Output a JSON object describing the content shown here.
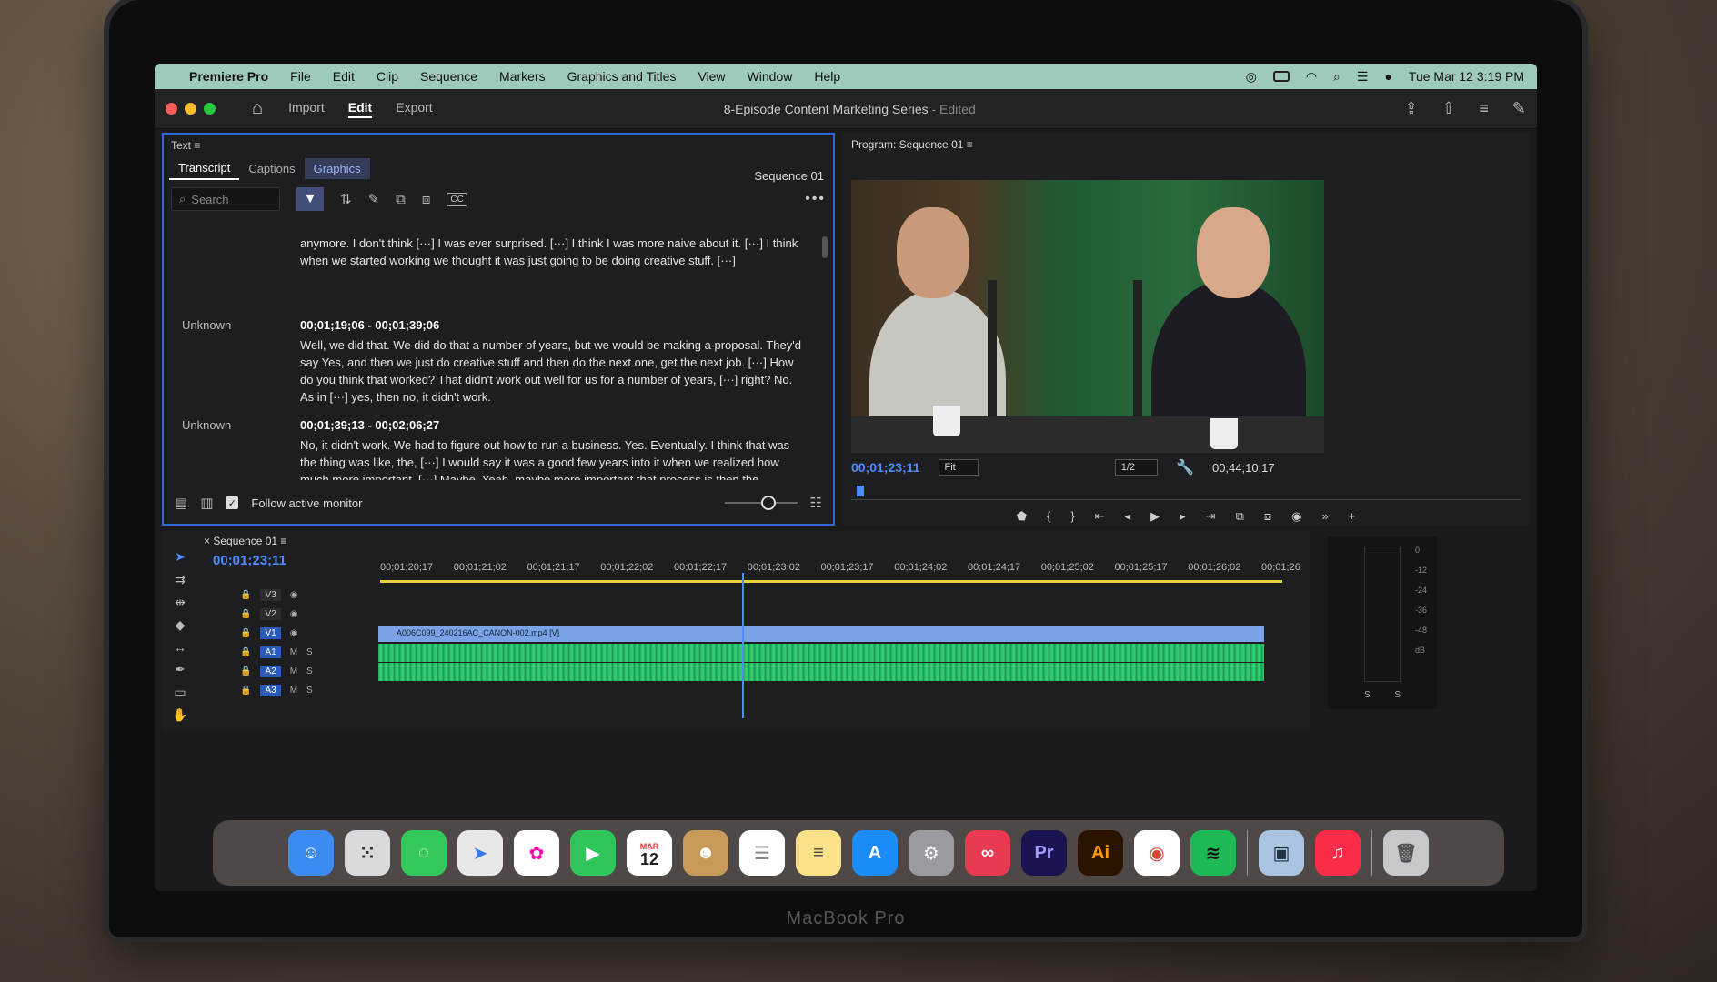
{
  "bezel": {
    "label": "MacBook Pro"
  },
  "menubar": {
    "app_name": "Premiere Pro",
    "items": [
      "File",
      "Edit",
      "Clip",
      "Sequence",
      "Markers",
      "Graphics and Titles",
      "View",
      "Window",
      "Help"
    ],
    "datetime": "Tue Mar 12  3:19 PM"
  },
  "header": {
    "modes": [
      "Import",
      "Edit",
      "Export"
    ],
    "active_mode": "Edit",
    "title": "8-Episode Content Marketing Series",
    "edited": "- Edited"
  },
  "text_panel": {
    "title": "Text",
    "tabs": [
      "Transcript",
      "Captions",
      "Graphics"
    ],
    "sequence": "Sequence 01",
    "search_placeholder": "Search",
    "cc": "CC",
    "top_snippet": "anymore. I don't think [···] I was ever surprised. [···] I think I was more naive about it. [···] I think when we started working we thought it was just going to be doing creative stuff. [···]",
    "entries": [
      {
        "speaker": "Unknown",
        "timecode": "00;01;19;06 - 00;01;39;06",
        "text": "Well, we did that. We did do that a number of years, but we would be making a proposal. They'd say Yes, and then we just do creative stuff and then do the next one, get the next job. [···] How do you think that worked? That didn't work out well for us for a number of years, [···] right? No. As in [···] yes, then no, it didn't work."
      },
      {
        "speaker": "Unknown",
        "timecode": "00;01;39;13 - 00;02;06;27",
        "text": "No, it didn't work. We had to figure out how to run a business. Yes. Eventually. I think that was the thing was like, the, [···] I would say it was a good few years into it when we realized how much more important. [···] Maybe. Yeah, maybe more important that process is then the creative, like, good creative comes from a really good process. [···]"
      }
    ],
    "follow_label": "Follow active monitor"
  },
  "program": {
    "title": "Program: Sequence 01",
    "timecode": "00;01;23;11",
    "zoom": "Fit",
    "resolution": "1/2",
    "duration": "00;44;10;17"
  },
  "timeline": {
    "sequence_tab": "Sequence 01",
    "timecode": "00;01;23;11",
    "ruler": [
      "00;01;20;17",
      "00;01;21;02",
      "00;01;21;17",
      "00;01;22;02",
      "00;01;22;17",
      "00;01;23;02",
      "00;01;23;17",
      "00;01;24;02",
      "00;01;24;17",
      "00;01;25;02",
      "00;01;25;17",
      "00;01;26;02",
      "00;01;26"
    ],
    "tracks": [
      {
        "label": "V3",
        "on": false
      },
      {
        "label": "V2",
        "on": false
      },
      {
        "label": "V1",
        "on": true
      },
      {
        "label": "A1",
        "on": true
      },
      {
        "label": "A2",
        "on": true
      },
      {
        "label": "A3",
        "on": true
      }
    ],
    "clip_name": "A006C099_240216AC_CANON-002.mp4 [V]",
    "meter_ticks": [
      "0",
      "-12",
      "-24",
      "-36",
      "-48",
      "dB"
    ],
    "meter_channels": [
      "S",
      "S"
    ]
  },
  "dock": {
    "calendar_month": "MAR",
    "calendar_day": "12",
    "premiere_label": "Pr",
    "illustrator_label": "Ai"
  }
}
